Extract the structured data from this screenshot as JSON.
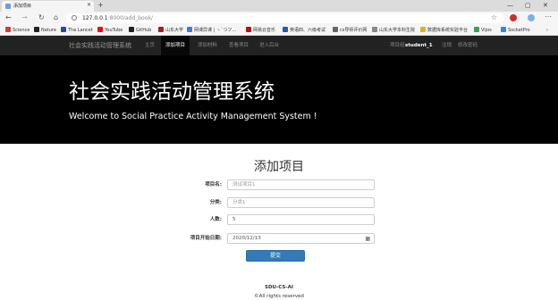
{
  "browser": {
    "tab_title": "添加项目",
    "url_host": "127.0.0.1",
    "url_path": ":8000/add_book/",
    "bookmarks": [
      {
        "label": "Science",
        "color": "#d83a2f"
      },
      {
        "label": "Nature",
        "color": "#222222"
      },
      {
        "label": "The Lancet",
        "color": "#1f4e9c"
      },
      {
        "label": "YouTube",
        "color": "#ff0000"
      },
      {
        "label": "GitHub",
        "color": "#222222"
      },
      {
        "label": "山东大学",
        "color": "#a02020"
      },
      {
        "label": "网课异课 | ヽ`つフ...",
        "color": "#3a7bd5"
      },
      {
        "label": "网易云音乐",
        "color": "#c20c0c"
      },
      {
        "label": "英语四、六级考试",
        "color": "#1f5faa"
      },
      {
        "label": "cs导师评价网",
        "color": "#666666"
      },
      {
        "label": "山东大学本科生院",
        "color": "#888888"
      },
      {
        "label": "数据库系统实验平台",
        "color": "#e0b020"
      },
      {
        "label": "Vijos",
        "color": "#3c9d5d"
      },
      {
        "label": "SocketPro",
        "color": "#2a8bd8"
      }
    ]
  },
  "site": {
    "brand": "社会实践活动管理系统",
    "nav": [
      "主页",
      "添加项目",
      "添加材料",
      "查看项目",
      "进入后台"
    ],
    "active_nav": "添加项目",
    "user_prefix": "项目组:",
    "user_name": "student_1",
    "right_links": [
      "注销",
      "修改密码"
    ]
  },
  "jumbotron": {
    "title": "社会实践活动管理系统",
    "subtitle": "Welcome to Social Practice Activity Management System !"
  },
  "form": {
    "title": "添加项目",
    "fields": [
      {
        "label": "项目名:",
        "value": "测试项目1",
        "kind": "text"
      },
      {
        "label": "分类:",
        "value": "分类1",
        "kind": "text"
      },
      {
        "label": "人数:",
        "value": "5",
        "kind": "number"
      },
      {
        "label": "项目开始日期:",
        "value": "2020/12/13",
        "kind": "date"
      }
    ],
    "submit_label": "提交"
  },
  "footer": {
    "line1": "SDU-CS-AI",
    "line2": "©All rights reserved"
  }
}
